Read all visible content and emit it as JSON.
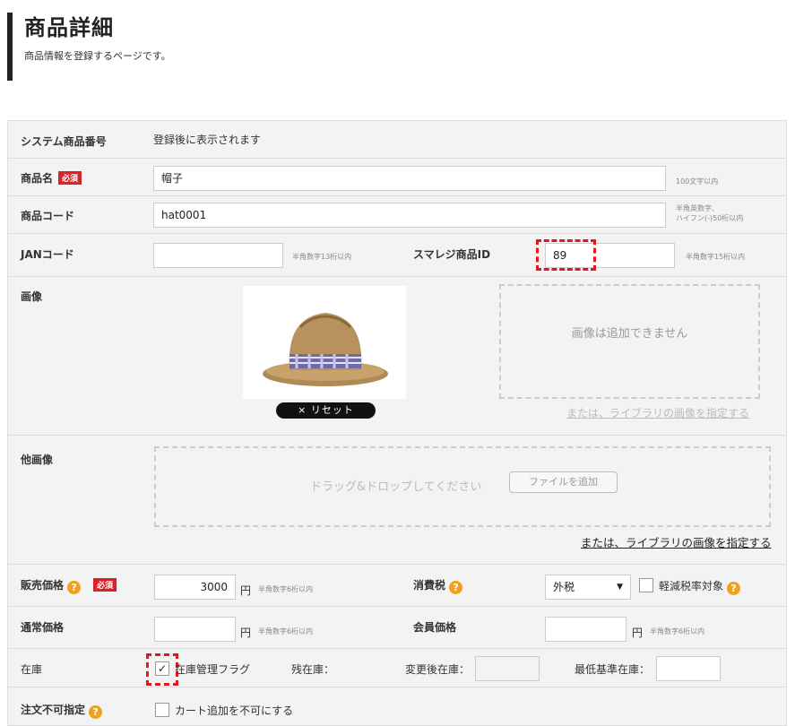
{
  "header": {
    "title": "商品詳細",
    "subtitle": "商品情報を登録するページです。"
  },
  "form": {
    "system_id": {
      "label": "システム商品番号",
      "value": "登録後に表示されます"
    },
    "name": {
      "label": "商品名",
      "required": "必須",
      "value": "帽子",
      "note": "100文字以内"
    },
    "code": {
      "label": "商品コード",
      "value": "hat0001",
      "note1": "半角英数字、",
      "note2": "ハイフン(-)50桁以内"
    },
    "jan": {
      "label": "JANコード",
      "value": "",
      "note": "半角数字13桁以内"
    },
    "smaregi": {
      "label": "スマレジ商品ID",
      "value": "89",
      "note": "半角数字15桁以内"
    },
    "image": {
      "label": "画像",
      "reset": "× リセット",
      "cannot_add": "画像は追加できません",
      "library_link": "または、ライブラリの画像を指定する"
    },
    "other_images": {
      "label": "他画像",
      "drop_text": "ドラッグ&ドロップしてください",
      "add_file": "ファイルを追加",
      "library_link": "または、ライブラリの画像を指定する"
    },
    "price": {
      "label": "販売価格",
      "required": "必須",
      "value": "3000",
      "unit": "円",
      "note": "半角数字6桁以内"
    },
    "tax": {
      "label": "消費税",
      "value": "外税",
      "reduced_label": "軽減税率対象"
    },
    "regular_price": {
      "label": "通常価格",
      "value": "",
      "unit": "円",
      "note": "半角数字6桁以内"
    },
    "member_price": {
      "label": "会員価格",
      "value": "",
      "unit": "円",
      "note": "半角数字6桁以内"
    },
    "stock": {
      "label": "在庫",
      "manage_label": "在庫管理フラグ",
      "manage_checked": true,
      "remaining_label": "残在庫：",
      "after_label": "変更後在庫：",
      "min_label": "最低基準在庫："
    },
    "order_restrict": {
      "label": "注文不可指定",
      "option": "カート追加を不可にする"
    }
  },
  "colors": {
    "required_badge": "#d9222a",
    "help_icon": "#f0a019",
    "highlight": "#e0171f",
    "link": "#222222"
  }
}
